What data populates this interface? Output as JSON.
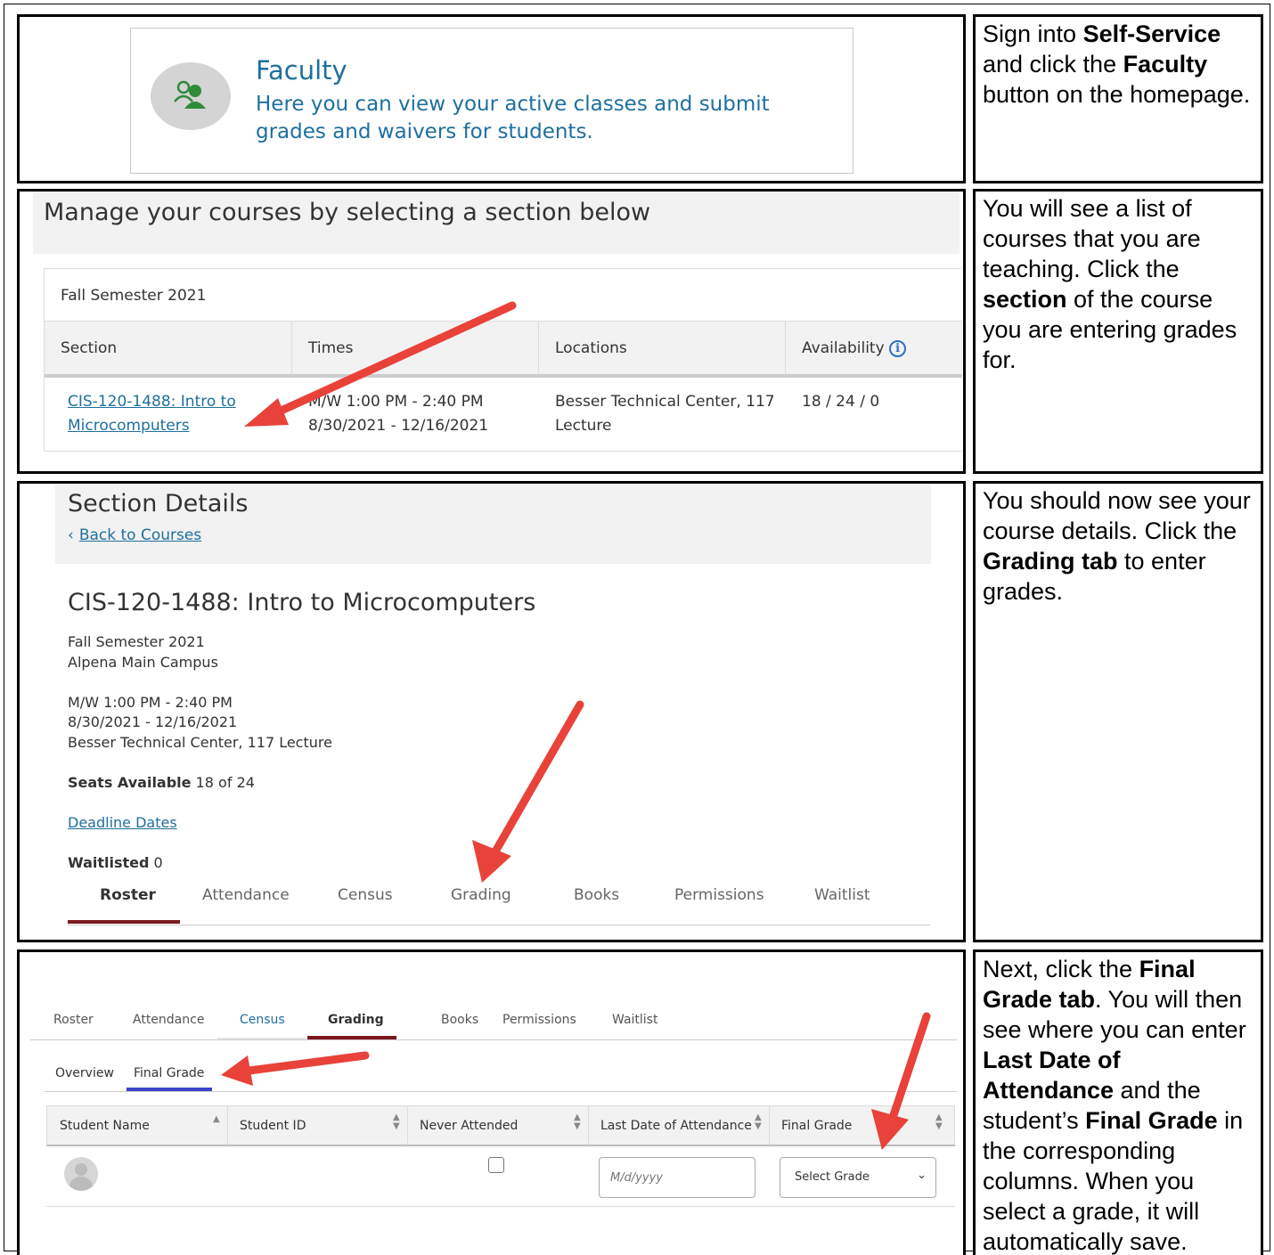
{
  "step1": {
    "faculty_card": {
      "title": "Faculty",
      "description": "Here you can view your active classes and submit grades and waivers for students.",
      "icon": "faculty-people-icon"
    },
    "instruction": {
      "t1": "Sign into ",
      "b1": "Self-Service",
      "t2": " and click the ",
      "b2": "Faculty",
      "t3": " button on the homepage."
    }
  },
  "step2": {
    "header": "Manage your courses by selecting a section below",
    "term": "Fall Semester 2021",
    "columns": [
      "Section",
      "Times",
      "Locations",
      "Availability"
    ],
    "row": {
      "section_line1": "CIS-120-1488: Intro to",
      "section_line2": "Microcomputers",
      "times_line1": "M/W 1:00 PM - 2:40 PM",
      "times_line2": "8/30/2021 - 12/16/2021",
      "location_line1": "Besser Technical Center, 117",
      "location_line2": "Lecture",
      "availability": "18 / 24 / 0"
    },
    "instruction": {
      "t1": "You will see a list of courses that you are teaching. Click the ",
      "b1": "section",
      "t2": " of the course you are entering grades for."
    }
  },
  "step3": {
    "header": "Section Details",
    "back_link": "Back to Courses",
    "course_title": "CIS-120-1488: Intro to Microcomputers",
    "term": "Fall Semester 2021",
    "campus": "Alpena Main Campus",
    "times": "M/W 1:00 PM - 2:40 PM",
    "dates": "8/30/2021 - 12/16/2021",
    "location": "Besser Technical Center, 117 Lecture",
    "seats_label": "Seats Available",
    "seats_value": "18 of 24",
    "deadline_link": "Deadline Dates",
    "waitlisted_label": "Waitlisted",
    "waitlisted_value": "0",
    "tabs": [
      "Roster",
      "Attendance",
      "Census",
      "Grading",
      "Books",
      "Permissions",
      "Waitlist"
    ],
    "instruction": {
      "t1": "You should now see your course details. Click the ",
      "b1": "Grading tab",
      "t2": " to enter grades."
    }
  },
  "step4": {
    "tabs": [
      "Roster",
      "Attendance",
      "Census",
      "Grading",
      "Books",
      "Permissions",
      "Waitlist"
    ],
    "subtabs": [
      "Overview",
      "Final Grade"
    ],
    "columns": [
      "Student Name",
      "Student ID",
      "Never Attended",
      "Last Date of Attendance",
      "Final Grade"
    ],
    "date_placeholder": "M/d/yyyy",
    "select_value": "Select Grade",
    "instruction": {
      "t1": "Next, click the ",
      "b1": "Final Grade tab",
      "t2": ". You will then see where you can enter ",
      "b2": "Last Date of Attendance",
      "t3": " and the student’s ",
      "b3": "Final Grade",
      "t4": " in the corresponding columns. When you select a grade, it will automatically save."
    }
  },
  "colors": {
    "link": "#1f6f9e",
    "arrow": "#e8423a",
    "active_tab": "#7a1820",
    "subtab_active": "#3b43c9"
  }
}
